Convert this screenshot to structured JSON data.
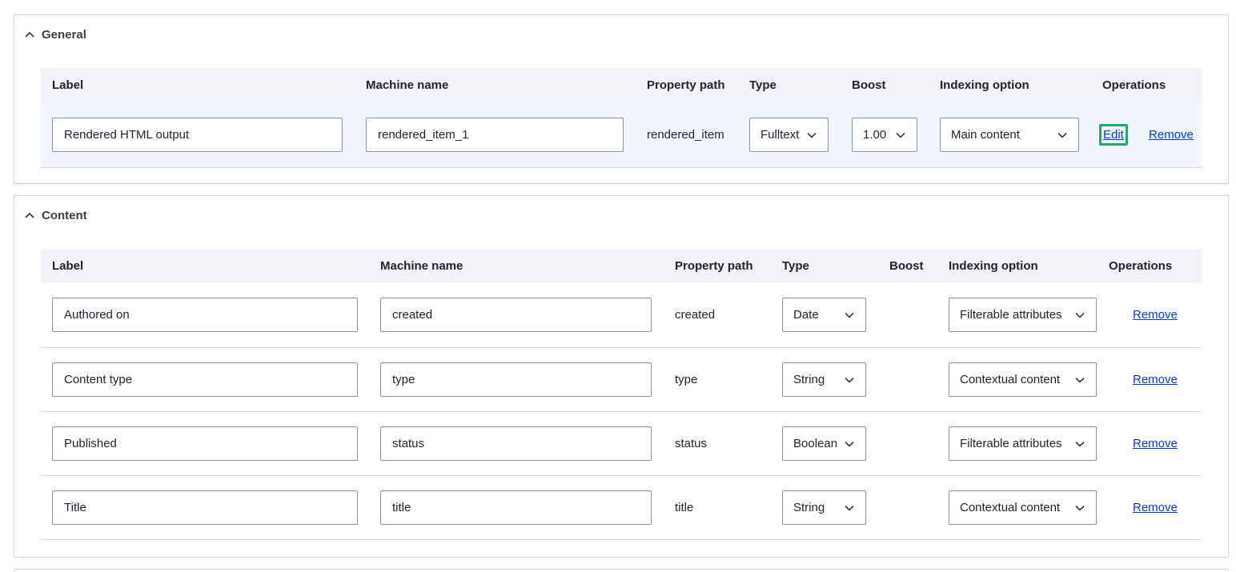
{
  "sections": [
    {
      "title": "General",
      "headers": [
        "Label",
        "Machine name",
        "Property path",
        "Type",
        "Boost",
        "Indexing option",
        "Operations"
      ],
      "rows": [
        {
          "label": "Rendered HTML output",
          "machine_name": "rendered_item_1",
          "property_path": "rendered_item",
          "type": "Fulltext",
          "boost": "1.00",
          "indexing": "Main content",
          "edit": "Edit",
          "remove": "Remove"
        }
      ]
    },
    {
      "title": "Content",
      "headers": [
        "Label",
        "Machine name",
        "Property path",
        "Type",
        "Boost",
        "Indexing option",
        "Operations"
      ],
      "rows": [
        {
          "label": "Authored on",
          "machine_name": "created",
          "property_path": "created",
          "type": "Date",
          "indexing": "Filterable attributes",
          "remove": "Remove"
        },
        {
          "label": "Content type",
          "machine_name": "type",
          "property_path": "type",
          "type": "String",
          "indexing": "Contextual content",
          "remove": "Remove"
        },
        {
          "label": "Published",
          "machine_name": "status",
          "property_path": "status",
          "type": "Boolean",
          "indexing": "Filterable attributes",
          "remove": "Remove"
        },
        {
          "label": "Title",
          "machine_name": "title",
          "property_path": "title",
          "type": "String",
          "indexing": "Contextual content",
          "remove": "Remove"
        }
      ]
    }
  ],
  "icons": {
    "collapse": "chevron-up-icon",
    "dropdown": "chevron-down-icon"
  },
  "colors": {
    "link": "#003ecc",
    "focus": "#26a769",
    "header_bg": "#f2f3f8",
    "row_highlight": "#f1f5fd"
  }
}
